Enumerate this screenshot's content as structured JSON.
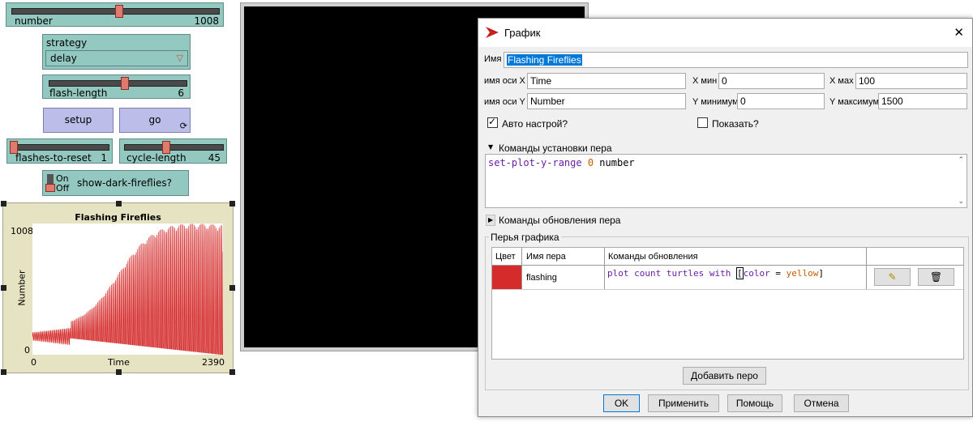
{
  "number_slider": {
    "label": "number",
    "value": "1008"
  },
  "strategy_chooser": {
    "label": "strategy",
    "value": "delay"
  },
  "flash_length_slider": {
    "label": "flash-length",
    "value": "6"
  },
  "buttons": {
    "setup": "setup",
    "go": "go"
  },
  "flashes_to_reset": {
    "label": "flashes-to-reset",
    "value": "1"
  },
  "cycle_length": {
    "label": "cycle-length",
    "value": "45"
  },
  "switch": {
    "on": "On",
    "off": "Off",
    "label": "show-dark-fireflies?"
  },
  "plot": {
    "title": "Flashing Fireflies",
    "y_max": "1008",
    "y_min": "0",
    "x_min": "0",
    "x_max": "2390",
    "x_label": "Time",
    "y_label": "Number",
    "pen_color": "#d42a2a"
  },
  "chart_data": {
    "type": "line",
    "title": "Flashing Fireflies",
    "xlabel": "Time",
    "ylabel": "Number",
    "xlim": [
      0,
      2390
    ],
    "ylim": [
      0,
      1008
    ],
    "series": [
      {
        "name": "flashing",
        "color": "#d42a2a"
      }
    ]
  },
  "dialog": {
    "title": "График",
    "close": "✕",
    "name_label": "Имя",
    "name_value": "Flashing Fireflies",
    "x_axis_label": "имя оси X",
    "x_axis_value": "Time",
    "x_min_label": "X мин",
    "x_min_value": "0",
    "x_max_label": "X мах",
    "x_max_value": "100",
    "y_axis_label": "имя оси Y",
    "y_axis_value": "Number",
    "y_min_label": "Y минимум",
    "y_min_value": "0",
    "y_max_label": "Y максимум",
    "y_max_value": "1500",
    "auto_label": "Авто настрой?",
    "show_label": "Показать?",
    "setup_section": "Команды установки пера",
    "setup_code": {
      "kw": "set-plot-y-range",
      "num": "0",
      "var": "number"
    },
    "update_section": "Команды обновления пера",
    "pens_section": "Перья графика",
    "pens_headers": {
      "color": "Цвет",
      "name": "Имя пера",
      "commands": "Команды обновления"
    },
    "pen_row": {
      "name": "flashing",
      "color": "#d62b2b",
      "code": {
        "p1": "plot count turtles with",
        "open": "[",
        "p2": "color",
        "p3": " = ",
        "p4": "yellow",
        "close": "]"
      }
    },
    "add_pen": "Добавить перо",
    "ok": "OK",
    "apply": "Применить",
    "help": "Помощь",
    "cancel": "Отмена"
  }
}
